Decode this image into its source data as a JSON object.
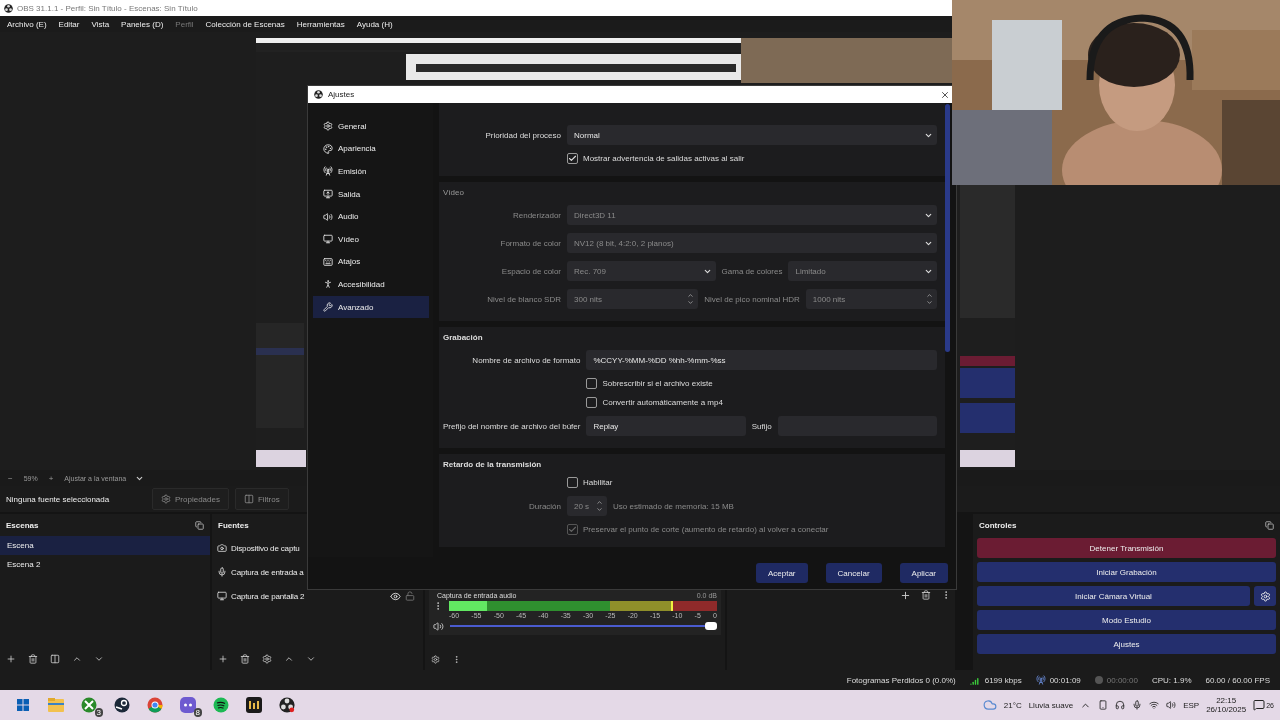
{
  "window": {
    "title": "OBS 31.1.1 - Perfil: Sin Título - Escenas: Sin Título"
  },
  "menu": [
    {
      "label": "Archivo (E)",
      "disabled": false
    },
    {
      "label": "Editar",
      "disabled": false
    },
    {
      "label": "Vista",
      "disabled": false
    },
    {
      "label": "Paneles (D)",
      "disabled": false
    },
    {
      "label": "Perfil",
      "disabled": true
    },
    {
      "label": "Colección de Escenas",
      "disabled": false
    },
    {
      "label": "Herramientas",
      "disabled": false
    },
    {
      "label": "Ayuda (H)",
      "disabled": false
    }
  ],
  "zoom_bar": {
    "minus": "−",
    "zoom": "59%",
    "plus": "+",
    "fit": "Ajustar a la ventana"
  },
  "source_toolbar": {
    "status": "Ninguna fuente seleccionada",
    "buttons": [
      {
        "label": "Propiedades",
        "kind": "properties",
        "disabled": true
      },
      {
        "label": "Filtros",
        "kind": "filters",
        "disabled": true
      }
    ]
  },
  "scenes": {
    "title": "Escenas",
    "items": [
      {
        "label": "Escena",
        "selected": true
      },
      {
        "label": "Escena 2",
        "selected": false
      }
    ]
  },
  "sources": {
    "title": "Fuentes",
    "items": [
      {
        "label": "Dispositivo de captu",
        "kind": "camera"
      },
      {
        "label": "Captura de entrada a",
        "kind": "audio"
      },
      {
        "label": "Captura de pantalla 2",
        "kind": "display",
        "visible": true,
        "locked": false
      }
    ]
  },
  "mixer": {
    "ticks": [
      "-60",
      "-55",
      "-50",
      "-45",
      "-40",
      "-35",
      "-30",
      "-25",
      "-20",
      "-15",
      "-10",
      "-5",
      "0"
    ],
    "channels": [
      {
        "name": "Captura de entrada audio",
        "reading": "0.0 dB",
        "muted": false,
        "meter": {
          "level": 0.14
        },
        "peak": {
          "level": 0.83
        },
        "fader": {
          "level": 1
        }
      }
    ]
  },
  "controls": {
    "title": "Controles",
    "buttons": [
      {
        "label": "Detener Transmisión",
        "kind": "plain",
        "active": true
      },
      {
        "label": "Iniciar Grabación",
        "kind": "plain",
        "active": false
      },
      {
        "label": "Iniciar Cámara Virtual",
        "kind": "gear",
        "active": false
      },
      {
        "label": "Modo Estudio",
        "kind": "plain",
        "active": false
      },
      {
        "label": "Ajustes",
        "kind": "plain",
        "active": false
      }
    ]
  },
  "status_bar": [
    {
      "kind": "text",
      "text": "Fotogramas Perdidos 0 (0.0%)"
    },
    {
      "kind": "bitrate",
      "text": "6199 kbps"
    },
    {
      "kind": "stream",
      "text": "00:01:09"
    },
    {
      "kind": "record",
      "text": "00:00:00"
    },
    {
      "kind": "text",
      "text": "CPU: 1.9%"
    },
    {
      "kind": "text",
      "text": "60.00 / 60.00 FPS"
    }
  ],
  "settings": {
    "title": "Ajustes",
    "nav": [
      {
        "label": "General",
        "selected": false
      },
      {
        "label": "Apariencia",
        "selected": false
      },
      {
        "label": "Emisión",
        "selected": false
      },
      {
        "label": "Salida",
        "selected": false
      },
      {
        "label": "Audio",
        "selected": false
      },
      {
        "label": "Vídeo",
        "selected": false
      },
      {
        "label": "Atajos",
        "selected": false
      },
      {
        "label": "Accesibilidad",
        "selected": false
      },
      {
        "label": "Avanzado",
        "selected": true
      }
    ],
    "sections": [
      {
        "disabled": false,
        "rows": [
          {
            "kind": "select",
            "label": "Prioridad del proceso",
            "value": "Normal"
          },
          {
            "kind": "checkbox",
            "label": "Mostrar advertencia de salidas activas al salir",
            "checked": true
          }
        ]
      },
      {
        "title": "Vídeo",
        "disabled": true,
        "rows": [
          {
            "kind": "select",
            "label": "Renderizador",
            "value": "Direct3D 11"
          },
          {
            "kind": "select",
            "label": "Formato de color",
            "value": "NV12 (8 bit, 4:2:0, 2 planos)"
          },
          {
            "kind": "pair",
            "items": [
              {
                "kind": "select",
                "label": "Espacio de color",
                "value": "Rec. 709"
              },
              {
                "kind": "select",
                "label": "Gama de colores",
                "value": "Limitado"
              }
            ]
          },
          {
            "kind": "pair",
            "items": [
              {
                "kind": "spin",
                "label": "Nivel de blanco SDR",
                "value": "300 nits"
              },
              {
                "kind": "spin",
                "label": "Nivel de pico nominal HDR",
                "value": "1000 nits"
              }
            ]
          }
        ]
      },
      {
        "title": "Grabación",
        "disabled": false,
        "rows": [
          {
            "kind": "input",
            "label": "Nombre de archivo de formato",
            "value": "%CCYY-%MM-%DD %hh-%mm-%ss"
          },
          {
            "kind": "checkbox",
            "label": "Sobrescribir si el archivo existe",
            "checked": false
          },
          {
            "kind": "checkbox",
            "label": "Convertir automáticamente a mp4",
            "checked": false
          },
          {
            "kind": "pair",
            "items": [
              {
                "kind": "input",
                "label": "Prefijo del nombre de archivo del búfer",
                "value": "Replay"
              },
              {
                "kind": "input",
                "label": "Sufijo"
              }
            ]
          }
        ]
      },
      {
        "title": "Retardo de la transmisión",
        "disabled": false,
        "rows": [
          {
            "kind": "checkbox",
            "label": "Habilitar",
            "checked": false,
            "disabled": false
          },
          {
            "kind": "spin",
            "label": "Duración",
            "value": "20 s",
            "note": "Uso estimado de memoria: 15 MB",
            "disabled": true
          },
          {
            "kind": "checkbox",
            "label": "Preservar el punto de corte (aumento de retardo) al volver a conectar",
            "checked": true,
            "disabled": true
          }
        ]
      }
    ],
    "buttons": [
      "Aceptar",
      "Cancelar",
      "Aplicar"
    ]
  },
  "taskbar": {
    "apps": [
      {
        "kind": "explorer"
      },
      {
        "kind": "xbox",
        "badge": "3"
      },
      {
        "kind": "steam"
      },
      {
        "kind": "chrome"
      },
      {
        "kind": "discord",
        "badge": "8"
      },
      {
        "kind": "spotify"
      },
      {
        "kind": "medal"
      },
      {
        "kind": "obs"
      }
    ],
    "tray": {
      "temperature": "21°C",
      "weather": "Lluvia suave",
      "language": "ESP",
      "time": "22:15",
      "date": "26/10/2025",
      "notifications": "26"
    }
  }
}
